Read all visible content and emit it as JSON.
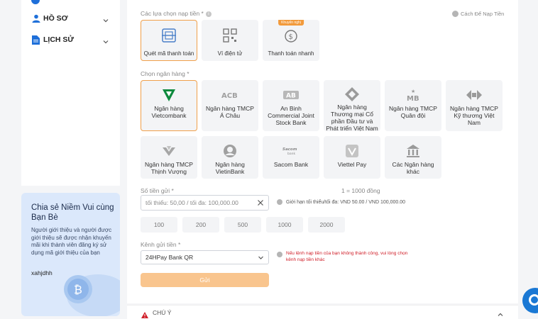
{
  "sidebar": {
    "items": [
      {
        "label": "HỒ SƠ"
      },
      {
        "label": "LỊCH SỬ"
      }
    ]
  },
  "promo": {
    "title": "Chia sẻ Niềm Vui cùng Bạn Bè",
    "description": "Người giới thiệu và người được giới thiệu sẽ được nhận khuyến mãi khi thành viên đăng ký sử dụng mã giới thiệu của bạn",
    "code": "xahjdhh"
  },
  "deposit": {
    "method_label": "Các lựa chọn nạp tiền *",
    "guide_link": "Cách Để Nạp Tiền",
    "methods": [
      {
        "label": "Quét mã thanh toán",
        "selected": true
      },
      {
        "label": "Ví điện tử",
        "selected": false
      },
      {
        "label": "Thanh toán nhanh",
        "badge": "Khuyến nghị",
        "selected": false
      }
    ],
    "bank_label": "Chọn ngân hàng *",
    "banks": [
      {
        "name": "Ngân hàng Vietcombank",
        "logo": "VCB",
        "selected": true
      },
      {
        "name": "Ngân hàng TMCP Á Châu",
        "logo": "ACB"
      },
      {
        "name": "An Binh Commercial Joint Stock Bank",
        "logo": "AB"
      },
      {
        "name": "Ngân hàng Thương mại Cổ phần Đầu tư và Phát triển Việt Nam",
        "logo": "BIDV"
      },
      {
        "name": "Ngân hàng TMCP Quân đội",
        "logo": "MB"
      },
      {
        "name": "Ngân hàng TMCP Kỹ thương Việt Nam",
        "logo": "TCB"
      },
      {
        "name": "Ngân hàng TMCP Thịnh Vượng",
        "logo": "VPB"
      },
      {
        "name": "Ngân hàng VietinBank",
        "logo": "CTG"
      },
      {
        "name": "Sacom Bank",
        "logo": "Sacom bank"
      },
      {
        "name": "Viettel Pay",
        "logo": "VTP"
      },
      {
        "name": "Các Ngân hàng khác",
        "logo": "BANK"
      }
    ],
    "amount_label": "Số tiền gửi *",
    "rate": "1 = 1000 đồng",
    "amount_placeholder": "tối thiểu: 50,00 / tối đa: 100,000.00",
    "limit_text": "Giới hạn tối thiểu/tối đa: VND 50.00 / VND 100,000.00",
    "chips": [
      "100",
      "200",
      "500",
      "1000",
      "2000"
    ],
    "channel_label": "Kênh gửi tiền *",
    "channel_value": "24HPay Bank QR",
    "channel_note": "Nếu lệnh nạp tiền của bạn không thành công, vui lòng chọn kênh nạp tiền khác",
    "submit_label": "Gửi"
  },
  "notice": {
    "label": "CHÚ Ý"
  },
  "colors": {
    "accent": "#f0a04b",
    "submit": "#f9c58e",
    "warning": "#d0202a",
    "promo_bg": "#dbe8fb"
  }
}
